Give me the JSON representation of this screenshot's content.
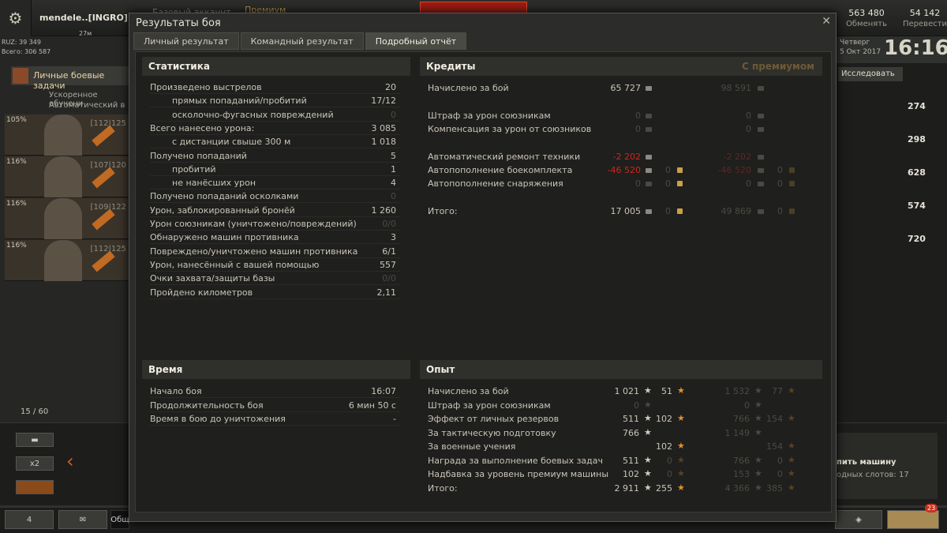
{
  "hangar": {
    "username": "mendele..[INGRO]",
    "account_type": "Базовый аккаунт",
    "premium_label": "Премиум",
    "ping_label": "27м",
    "ruz_line1": "RUZ: 39 349",
    "ruz_line2": "Всего: 306 587",
    "missions_label": "Личные боевые задачи",
    "task1": "Ускоренное обучени",
    "task2": "Автоматический в",
    "currency1_value": "563 480",
    "currency1_label": "Обменять",
    "currency2_value": "54 142",
    "currency2_label": "Перевести",
    "clock": "16:16",
    "day": "Четверг",
    "date": "5 Окт 2017",
    "research_label": "Исследовать",
    "right_values": [
      "274",
      "298",
      "628",
      "574",
      "720"
    ],
    "crew_pcts": [
      "105%",
      "116%",
      "116%",
      "116%"
    ],
    "crew_levels": [
      "[112|125",
      "[107|120",
      "[109|122",
      "[112|125"
    ],
    "counter": "15 / 60",
    "multiplier": "x2",
    "hangar_buy_line1": "пить машину",
    "hangar_buy_line2": "одных слотов: 17",
    "platoon_count": "4",
    "chat_label": "Общ",
    "notif_count": "23"
  },
  "dialog": {
    "title": "Результаты боя",
    "tabs": [
      "Личный результат",
      "Командный результат",
      "Подробный отчёт"
    ],
    "stats_title": "Статистика",
    "stats": [
      {
        "label": "Произведено выстрелов",
        "value": "20",
        "indent": false,
        "dim": false
      },
      {
        "label": "прямых попаданий/пробитий",
        "value": "17/12",
        "indent": true,
        "dim": false
      },
      {
        "label": "осколочно-фугасных повреждений",
        "value": "0",
        "indent": true,
        "dim": true
      },
      {
        "label": "Всего нанесено урона:",
        "value": "3 085",
        "indent": false,
        "dim": false
      },
      {
        "label": "с дистанции свыше 300 м",
        "value": "1 018",
        "indent": true,
        "dim": false
      },
      {
        "label": "Получено попаданий",
        "value": "5",
        "indent": false,
        "dim": false
      },
      {
        "label": "пробитий",
        "value": "1",
        "indent": true,
        "dim": false
      },
      {
        "label": "не нанёсших урон",
        "value": "4",
        "indent": true,
        "dim": false
      },
      {
        "label": "Получено попаданий осколками",
        "value": "0",
        "indent": false,
        "dim": true
      },
      {
        "label": "Урон, заблокированный бронёй",
        "value": "1 260",
        "indent": false,
        "dim": false
      },
      {
        "label": "Урон союзникам (уничтожено/повреждений)",
        "value": "0/0",
        "indent": false,
        "dim": true
      },
      {
        "label": "Обнаружено машин противника",
        "value": "3",
        "indent": false,
        "dim": false
      },
      {
        "label": "Повреждено/уничтожено машин противника",
        "value": "6/1",
        "indent": false,
        "dim": false
      },
      {
        "label": "Урон, нанесённый с вашей помощью",
        "value": "557",
        "indent": false,
        "dim": false
      },
      {
        "label": "Очки захвата/защиты базы",
        "value": "0/0",
        "indent": false,
        "dim": true
      },
      {
        "label": "Пройдено километров",
        "value": "2,11",
        "indent": false,
        "dim": false
      }
    ],
    "credits_title": "Кредиты",
    "credits_premium_title": "С премиумом",
    "credits": [
      {
        "label": "Начислено за бой",
        "c": "65 727",
        "cstyle": "n",
        "g": "",
        "p": "98 591",
        "pstyle": "dim",
        "pg": ""
      },
      {
        "label": "Штраф за урон союзникам",
        "c": "0",
        "cstyle": "dim",
        "g": "",
        "p": "0",
        "pstyle": "dim",
        "pg": ""
      },
      {
        "label": "Компенсация за урон от союзников",
        "c": "0",
        "cstyle": "dim",
        "g": "",
        "p": "0",
        "pstyle": "dim",
        "pg": ""
      },
      {
        "label": "Автоматический ремонт техники",
        "c": "-2 202",
        "cstyle": "red",
        "g": "",
        "p": "-2 202",
        "pstyle": "dimred",
        "pg": ""
      },
      {
        "label": "Автопополнение боекомплекта",
        "c": "-46 520",
        "cstyle": "red",
        "g": "0",
        "p": "-46 520",
        "pstyle": "dimred",
        "pg": "0"
      },
      {
        "label": "Автопополнение снаряжения",
        "c": "0",
        "cstyle": "dim",
        "g": "0",
        "p": "0",
        "pstyle": "dim",
        "pg": "0"
      },
      {
        "label": "Итого:",
        "c": "17 005",
        "cstyle": "n",
        "g": "0",
        "p": "49 869",
        "pstyle": "dim",
        "pg": "0"
      }
    ],
    "time_title": "Время",
    "time": [
      {
        "label": "Начало боя",
        "value": "16:07"
      },
      {
        "label": "Продолжительность боя",
        "value": "6 мин 50 с"
      },
      {
        "label": "Время в бою до уничтожения",
        "value": "-"
      }
    ],
    "exp_title": "Опыт",
    "exp": [
      {
        "label": "Начислено за бой",
        "x": "1 021",
        "xs": "n",
        "f": "51",
        "fs": "n",
        "px": "1 532",
        "pf": "77"
      },
      {
        "label": "Штраф за урон союзникам",
        "x": "0",
        "xs": "dim",
        "f": "",
        "fs": "",
        "px": "0",
        "pf": ""
      },
      {
        "label": "Эффект от личных резервов",
        "x": "511",
        "xs": "n",
        "f": "102",
        "fs": "n",
        "px": "766",
        "pf": "154"
      },
      {
        "label": "За тактическую подготовку",
        "x": "766",
        "xs": "n",
        "f": "",
        "fs": "",
        "px": "1 149",
        "pf": ""
      },
      {
        "label": "За военные учения",
        "x": "",
        "xs": "",
        "f": "102",
        "fs": "n",
        "px": "",
        "pf": "154"
      },
      {
        "label": "Награда за выполнение боевых задач",
        "x": "511",
        "xs": "n",
        "f": "0",
        "fs": "dim",
        "px": "766",
        "pf": "0"
      },
      {
        "label": "Надбавка за уровень премиум машины",
        "x": "102",
        "xs": "n",
        "f": "0",
        "fs": "dim",
        "px": "153",
        "pf": "0"
      },
      {
        "label": "Итого:",
        "x": "2 911",
        "xs": "n",
        "f": "255",
        "fs": "n",
        "px": "4 366",
        "pf": "385"
      }
    ]
  }
}
